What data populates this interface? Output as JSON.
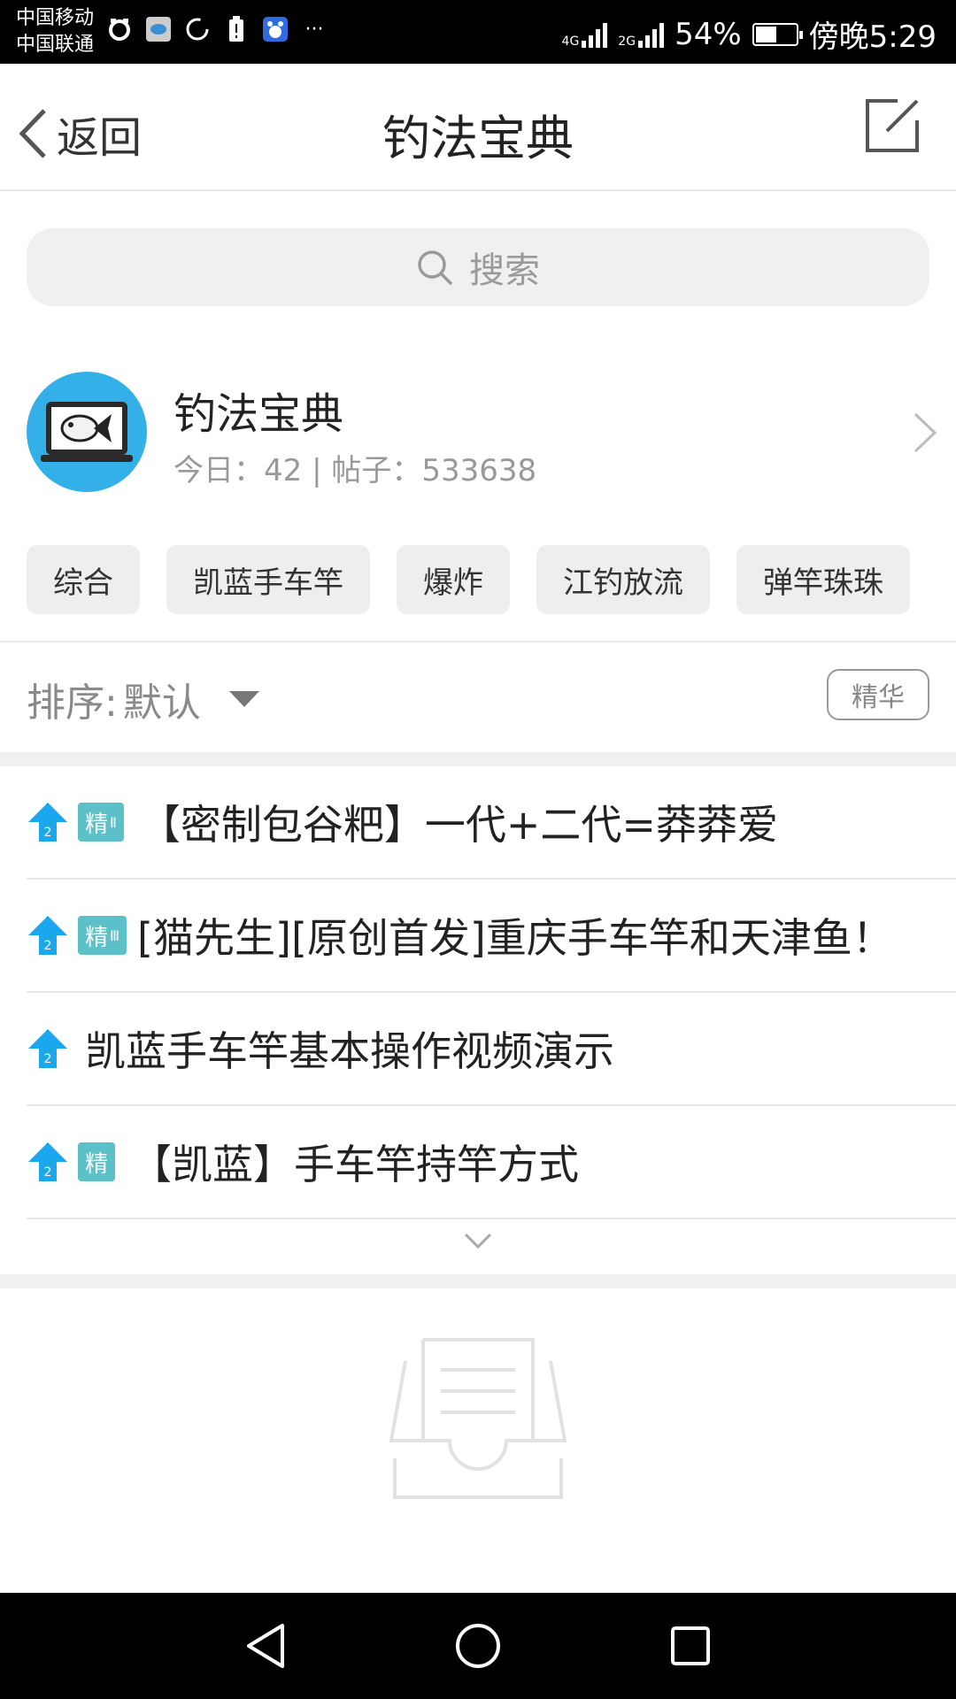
{
  "status_bar": {
    "carrier_1": "中国移动",
    "carrier_2": "中国联通",
    "network_1": "4G",
    "network_2": "2G",
    "battery_text": "54%",
    "battery_level": 0.54,
    "time": "傍晚5:29",
    "more": "···"
  },
  "header": {
    "back_label": "返回",
    "title": "钓法宝典"
  },
  "search": {
    "placeholder": "搜索"
  },
  "forum": {
    "name": "钓法宝典",
    "today_label": "今日：",
    "today_count": "42",
    "separator": " | ",
    "posts_label": "帖子：",
    "posts_count": "533638"
  },
  "tags": [
    {
      "label": "综合"
    },
    {
      "label": "凯蓝手车竿"
    },
    {
      "label": "爆炸"
    },
    {
      "label": "江钓放流"
    },
    {
      "label": "弹竿珠珠"
    }
  ],
  "sort": {
    "label": "排序:",
    "value": "默认",
    "essence_button": "精华"
  },
  "posts": [
    {
      "badge": "精",
      "badge_sub": "Ⅱ",
      "title": "【密制包谷粑】一代+二代=莽莽爱"
    },
    {
      "badge": "精",
      "badge_sub": "Ⅲ",
      "title": "[猫先生][原创首发]重庆手车竿和天津鱼！"
    },
    {
      "badge": "",
      "badge_sub": "",
      "title": "凯蓝手车竿基本操作视频演示"
    },
    {
      "badge": "精",
      "badge_sub": "",
      "title": "【凯蓝】手车竿持竿方式"
    }
  ],
  "colors": {
    "accent_blue": "#1aa7ec",
    "essence_badge": "#5bc0c8",
    "avatar_bg": "#34b0e8"
  }
}
